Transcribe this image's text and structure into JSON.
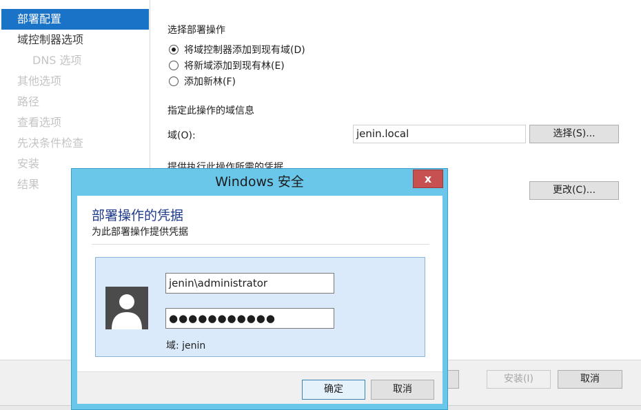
{
  "sidebar": {
    "items": [
      {
        "label": "部署配置"
      },
      {
        "label": "域控制器选项"
      },
      {
        "label": "DNS 选项"
      },
      {
        "label": "其他选项"
      },
      {
        "label": "路径"
      },
      {
        "label": "查看选项"
      },
      {
        "label": "先决条件检查"
      },
      {
        "label": "安装"
      },
      {
        "label": "结果"
      }
    ]
  },
  "main": {
    "deploy_op_heading": "选择部署操作",
    "options": [
      {
        "label": "将域控制器添加到现有域(D)",
        "selected": true
      },
      {
        "label": "将新域添加到现有林(E)",
        "selected": false
      },
      {
        "label": "添加新林(F)",
        "selected": false
      }
    ],
    "domain_info_heading": "指定此操作的域信息",
    "domain_label": "域(O):",
    "domain_value": "jenin.local",
    "select_button": "选择(S)...",
    "cred_heading": "提供执行此操作所需的凭据",
    "change_button": "更改(C)..."
  },
  "footer": {
    "next_button": ">",
    "install_button": "安装(I)",
    "cancel_button": "取消"
  },
  "dialog": {
    "title": "Windows 安全",
    "close_glyph": "x",
    "heading": "部署操作的凭据",
    "subheading": "为此部署操作提供凭据",
    "username": "jenin\\administrator",
    "password_mask": "●●●●●●●●●●●",
    "domain_text": "域: jenin",
    "ok_button": "确定",
    "cancel_button": "取消"
  },
  "colors": {
    "accent": "#1a73c6",
    "dialog_frame": "#6ac7ea",
    "close_red": "#c75050",
    "tile_bg": "#dbeafb"
  }
}
